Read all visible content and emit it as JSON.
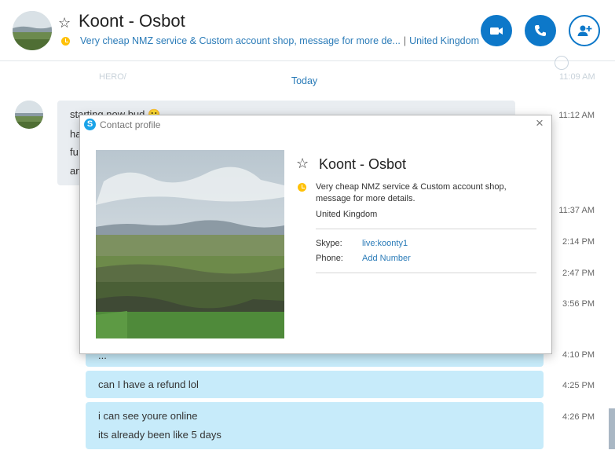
{
  "header": {
    "contact_name": "Koont - Osbot",
    "mood": "Very cheap NMZ service & Custom account shop, message for more de...",
    "separator": "|",
    "location": "United Kingdom",
    "icons": [
      "star-icon",
      "mood-icon",
      "video-call-icon",
      "audio-call-icon",
      "add-people-icon"
    ],
    "accent": "#0d78c9"
  },
  "chat": {
    "ghost_text": "HERO/",
    "ghost_time": "11:09 AM",
    "date_divider": "Today",
    "incoming": {
      "lines": [
        "starting now bud 😀",
        "ha",
        "fu",
        "an"
      ],
      "time": "11:12 AM"
    },
    "hidden_times": [
      "11:37 AM",
      "2:14 PM",
      "2:47 PM",
      "3:56 PM"
    ],
    "outgoing": [
      {
        "lines": [
          "..."
        ],
        "time": "4:10 PM"
      },
      {
        "lines": [
          "can I have a refund lol"
        ],
        "time": "4:25 PM"
      },
      {
        "lines": [
          "i can see youre online",
          "its already been like 5 days"
        ],
        "time": "4:26 PM"
      }
    ],
    "bubble_colors": {
      "incoming": "#e9edf1",
      "outgoing": "#c7ebfa"
    }
  },
  "popup": {
    "title": "Contact profile",
    "close_glyph": "×",
    "name": "Koont - Osbot",
    "mood": "Very cheap NMZ service & Custom account shop, message for more details.",
    "location": "United Kingdom",
    "skype_label": "Skype:",
    "skype_value": "live:koonty1",
    "phone_label": "Phone:",
    "phone_value": "Add Number"
  }
}
